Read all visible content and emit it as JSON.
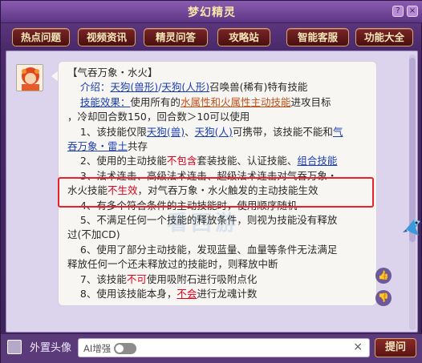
{
  "window": {
    "title": "梦幻精灵",
    "btn_help": "?",
    "btn_close": "×"
  },
  "nav": [
    "热点问题",
    "视频资讯",
    "精灵问答",
    "攻略站",
    "智能客服",
    "功能大全"
  ],
  "answer": {
    "heading": "【气吞万象・水火】",
    "intro_label": "介绍：",
    "intro_link1": "天狗(兽形)",
    "intro_sep": "/",
    "intro_link2": "天狗(人形)",
    "intro_tail": "召唤兽(稀有)特有技能",
    "effect_label": "技能效果：",
    "effect_a": "使用所有的",
    "effect_link": "水属性和火属性主动技能",
    "effect_b": "进攻目标",
    "line3": "，冷却回合数150，回合数＞10可以使用",
    "n1_a": "1、该技能仅限",
    "n1_link1": "天狗(兽)",
    "n1_sep": "、",
    "n1_link2": "天狗(人)",
    "n1_b": "可携带，该技能不能和",
    "n1_link3a": "气",
    "n1_link3b": "吞万象・雷土",
    "n1_tail": "共存",
    "n2_a": "2、使用的主动技能",
    "n2_red": "不包含",
    "n2_b": "套装技能、认证技能、",
    "n2_link": "组合技能",
    "n3_a": "3、法术连击、高级法术连击、超级法术连击对气吞万象・",
    "n3_b": "水火技能",
    "n3_red": "不生效",
    "n3_c": "，对气吞万象・水火触发的主动技能生效",
    "n4": "4、有多个符合条件的主动技能时，使用顺序随机",
    "n5_a": "5、不满足任何一个技能的释放条件，则视为技能没有释放",
    "n5_b": "过(不加CD)",
    "n6_a": "6、使用了部分主动技能，发现蓝量、血量等条件无法满足",
    "n6_b": "释放任何一个还未释放过的技能时，则释放中断",
    "n7_a": "7、该技能",
    "n7_red": "不可",
    "n7_b": "使用吸附石进行吸附点化",
    "n8_a": "8、使用该技能本身，",
    "n8_red": "不会",
    "n8_b": "进行龙魂计数"
  },
  "watermark": "看西游",
  "side_buttons": {
    "like": "👍",
    "dislike": "👎"
  },
  "bottom": {
    "avatar_label": "外置头像",
    "ai_label": "AI增强",
    "clear": "×",
    "ask_button": "提问"
  }
}
